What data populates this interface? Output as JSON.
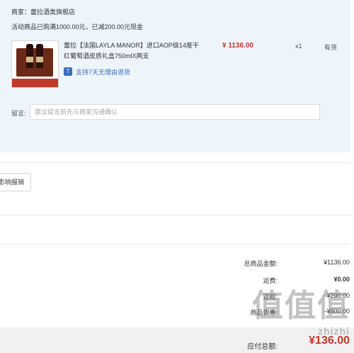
{
  "order": {
    "merchant": "商家：蕾拉酒类旗舰店",
    "promo": "活动商品已购满1000.00元，已减200.00元现金",
    "product": {
      "title": "蕾拉【法国LAYLA MANOR】进口AOP级14度干红葡萄酒皮质礼盒750mlX两支",
      "return_policy": "支持7天无理由退货",
      "return_icon": "7",
      "price": "¥ 1136.00",
      "quantity": "x1",
      "stock": "有货"
    },
    "message": {
      "label": "留言:",
      "placeholder": "建议留言前先与商家沟通确认",
      "value": ""
    }
  },
  "invoice_button": "影响报销",
  "summary": [
    {
      "label": "总商品金额:",
      "value": "¥1136.00"
    },
    {
      "label": "运费:",
      "value": "¥0.00"
    },
    {
      "label": "返现:",
      "value": "-¥200.00"
    },
    {
      "label": "商品优惠:",
      "value": "-¥800.00"
    }
  ],
  "total": {
    "label": "应付总额:",
    "value": "¥136.00"
  },
  "watermark": {
    "glyphs": "值值值",
    "sub": "zhizhi"
  },
  "colors": {
    "panel_bg": "#edf5fb",
    "price_red": "#c0392b",
    "link_blue": "#3b6fb8"
  }
}
